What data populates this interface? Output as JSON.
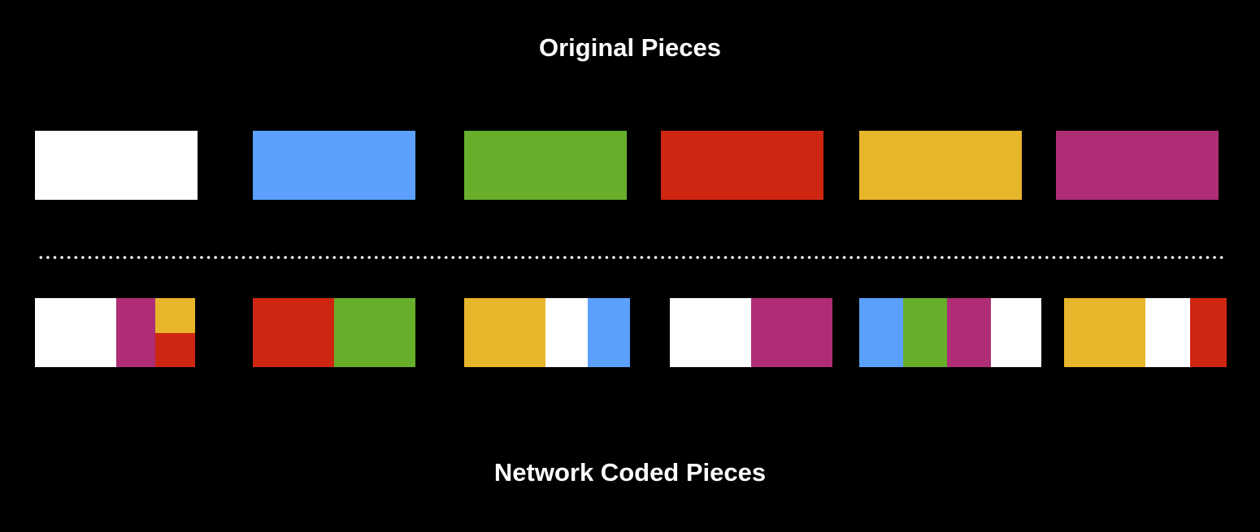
{
  "titles": {
    "top": "Original Pieces",
    "bottom": "Network Coded Pieces"
  },
  "colors": {
    "white": "#ffffff",
    "blue": "#5aa0fc",
    "green": "#67ae2b",
    "red": "#cf2612",
    "yellow": "#e7b62a",
    "magenta": "#ae2d75",
    "background": "#000000"
  },
  "original_pieces": [
    "white",
    "blue",
    "green",
    "red",
    "yellow",
    "magenta"
  ],
  "coded_pieces": [
    [
      "white",
      "magenta",
      [
        "yellow",
        "red"
      ]
    ],
    [
      "red",
      "green"
    ],
    [
      "yellow",
      "white",
      "blue"
    ],
    [
      "white",
      "magenta"
    ],
    [
      "blue",
      "green",
      "magenta",
      "white"
    ],
    [
      "yellow",
      "white",
      "red"
    ]
  ]
}
